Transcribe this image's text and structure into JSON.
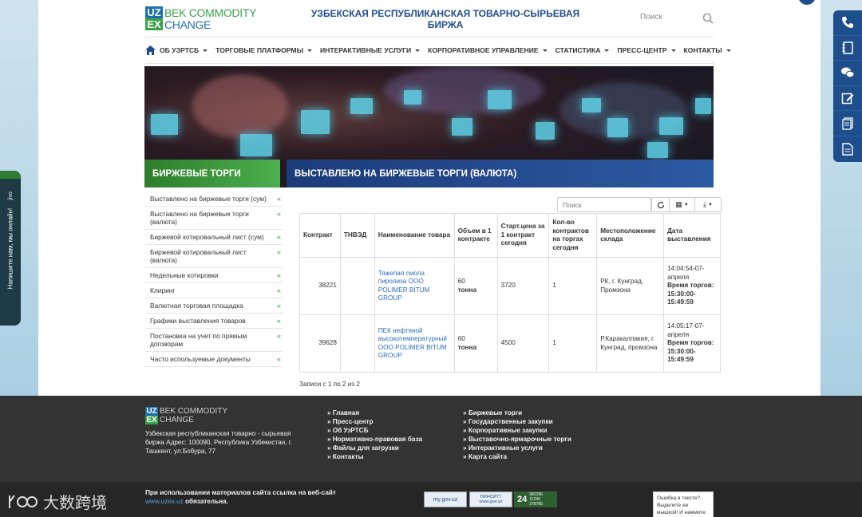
{
  "header": {
    "logo_uz": "UZ",
    "logo_bek": "BEK COMMODITY",
    "logo_ex": "EX",
    "logo_change": "CHANGE",
    "title": "УЗБЕКСКАЯ РЕСПУБЛИКАНСКАЯ ТОВАРНО-СЫРЬЕВАЯ БИРЖА",
    "search_placeholder": "Поиск"
  },
  "nav": {
    "items": [
      "ОБ УЗРТСБ",
      "ТОРГОВЫЕ ПЛАТФОРМЫ",
      "ИНТЕРАКТИВНЫЕ УСЛУГИ",
      "КОРПОРАТИВНОЕ УПРАВЛЕНИЕ",
      "СТАТИСТИКА",
      "ПРЕСС-ЦЕНТР",
      "КОНТАКТЫ"
    ]
  },
  "banner": {
    "section_title": "БИРЖЕВЫЕ ТОРГИ",
    "page_title": "ВЫСТАВЛЕНО НА БИРЖЕВЫЕ ТОРГИ (ВАЛЮТА)"
  },
  "sidebar": {
    "items": [
      "Выставлено на биржевые торги (сум)",
      "Выставлено на биржевые торги (валюта)",
      "Биржевой котировальный лист (сум)",
      "Биржевой котировальный лист (валюта)",
      "Недельные котировки",
      "Клиринг",
      "Валютная торговая площадка",
      "Графики выставления товаров",
      "Постановка на учет по прямым договорам",
      "Часто используемые документы"
    ]
  },
  "table": {
    "search_placeholder": "Поиск",
    "headers": [
      "Контракт",
      "ТНВЭД",
      "Наименование товара",
      "Объем в 1 контракте",
      "Старт.цена за 1 контракт сегодня",
      "Кол-во контрактов на торгах сегодня",
      "Местоположение склада",
      "Дата выставления"
    ],
    "rows": [
      {
        "contract": "38221",
        "tnved": "",
        "name": "Тяжелая смола пиролиза ООО POLIMER BITUM GROUP",
        "volume": "60",
        "unit": "тонна",
        "price": "3720",
        "count": "1",
        "location": "РК, г. Кунград, Промзона",
        "date": "14:04:54-07-апреля",
        "time_label": "Время торгов:",
        "time": "15:30:00-15:49:59"
      },
      {
        "contract": "39628",
        "tnved": "",
        "name": "ПЕК нефтяной высокотемпературный ООО POLIMER BITUM GROUP",
        "volume": "60",
        "unit": "тонна",
        "price": "4500",
        "count": "1",
        "location": "Р.Каракалпакия, г. Кунград, промзона",
        "date": "14:05:17-07-апреля",
        "time_label": "Время торгов:",
        "time": "15:30:00-15:49:59"
      }
    ],
    "records": "Записи с 1 по 2 из 2"
  },
  "chat": {
    "label": "Напишите нам, мы онлайн!",
    "brand": "jivo"
  },
  "footer": {
    "address": "Узбекская республиканская товарно - сырьевая биржа Адрес: 100090, Республика Узбекистан, г. Ташкент, ул.Бобура, 77",
    "col1": [
      "Главная",
      "Пресс-центр",
      "Об УзРТСБ",
      "Нормативно-правовая база",
      "Файлы для загрузки",
      "Контакты"
    ],
    "col2": [
      "Биржевые торги",
      "Государственные закупки",
      "Корпоративные закупки",
      "Выставочно-ярмарочные торги",
      "Интерактивные услуги",
      "Карта сайта"
    ],
    "notice_start": "При использовании материалов сайта ссылка на веб-сайт",
    "notice_link": "www.uzex.uz",
    "notice_end": " обязательна.",
    "badge1": "my.gov.uz",
    "badge2": "ПИНСИТТ www.gov.uz",
    "badge3_num": "24",
    "badge3_stats": "982296 11240 278785",
    "error_text": "Ошибка в тексте? Выделите ее мышкой! И нажмите:"
  },
  "watermark": "大数跨境"
}
